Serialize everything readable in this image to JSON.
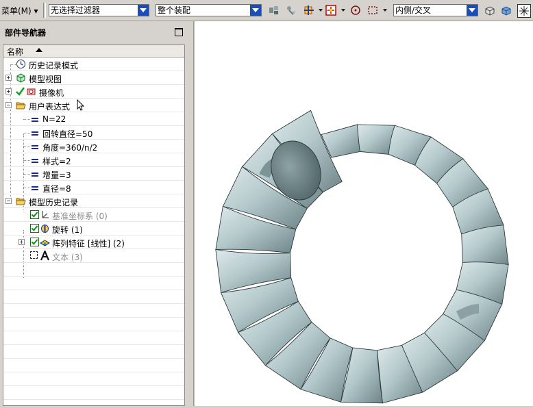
{
  "toolbar": {
    "menu_label": "菜单(M)",
    "filter_value": "无选择过滤器",
    "scope_value": "整个装配",
    "selection_mode_value": "内侧/交叉"
  },
  "navigator": {
    "title": "部件导航器",
    "column_header": "名称",
    "nodes": [
      {
        "label": "历史记录模式",
        "icon": "clock-icon"
      },
      {
        "label": "模型视图",
        "icon": "model-view-icon"
      },
      {
        "label": "摄像机",
        "icon": "camera-icon"
      },
      {
        "label": "用户表达式",
        "icon": "open-folder-icon"
      },
      {
        "label": "N=22",
        "icon": "equals-icon"
      },
      {
        "label": "回转直径=50",
        "icon": "equals-icon"
      },
      {
        "label": "角度=360/n/2",
        "icon": "equals-icon"
      },
      {
        "label": "样式=2",
        "icon": "equals-icon"
      },
      {
        "label": "增量=3",
        "icon": "equals-icon"
      },
      {
        "label": "直径=8",
        "icon": "equals-icon"
      },
      {
        "label": "模型历史记录",
        "icon": "open-folder-icon"
      },
      {
        "label": "基准坐标系 (0)",
        "icon": "datum-csys-icon"
      },
      {
        "label": "旋转 (1)",
        "icon": "revolve-icon"
      },
      {
        "label": "阵列特征 [线性] (2)",
        "icon": "pattern-icon"
      },
      {
        "label": "文本 (3)",
        "icon": "text-icon"
      }
    ]
  },
  "colors": {
    "model_fill": "#b9cfd3",
    "model_shadow": "#5c7478",
    "combo_arrow": "#1c4fb6"
  }
}
